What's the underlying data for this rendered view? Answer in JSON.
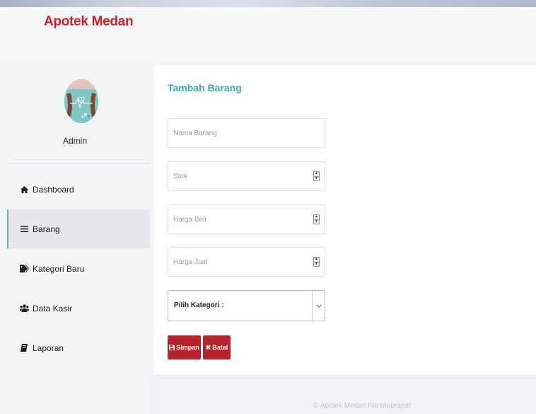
{
  "header": {
    "brand": "Apotek Medan"
  },
  "profile": {
    "name": "Admin"
  },
  "nav": {
    "items": [
      {
        "label": "Dashboard",
        "icon": "home-icon"
      },
      {
        "label": "Barang",
        "icon": "bars-icon"
      },
      {
        "label": "Kategori Baru",
        "icon": "tag-icon"
      },
      {
        "label": "Data Kasir",
        "icon": "users-icon"
      },
      {
        "label": "Laporan",
        "icon": "book-icon"
      }
    ],
    "active": "Barang"
  },
  "form": {
    "title": "Tambah Barang",
    "nama_placeholder": "Nama Barang",
    "stok_placeholder": "Stok",
    "harga_beli_placeholder": "Harga Beli",
    "harga_jual_placeholder": "Harga Jual",
    "kategori_selected": "Pilih Kategori :",
    "save_label": "Simpan",
    "cancel_label": "Batal"
  },
  "footer": {
    "text": "© Apotek Medan Rantauprapat"
  },
  "colors": {
    "brand": "#d01f27",
    "title": "#3aa9a8",
    "button": "#b8222a"
  }
}
